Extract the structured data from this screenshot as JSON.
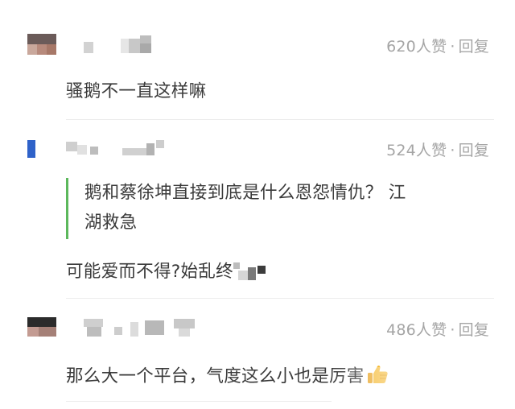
{
  "comments": [
    {
      "likes": "620人赞",
      "separator": "·",
      "reply_label": "回复",
      "text": "骚鹅不一直这样嘛"
    },
    {
      "likes": "524人赞",
      "separator": "·",
      "reply_label": "回复",
      "quote_line1": "鹅和蔡徐坤直接到底是什么恩怨情仇？ 江",
      "quote_line2": "湖救急",
      "text": "可能爱而不得?始乱终"
    },
    {
      "likes": "486人赞",
      "separator": "·",
      "reply_label": "回复",
      "text": "那么大一个平台，气度这么小也是厉害"
    }
  ],
  "icons": {
    "thumb": "thumbs-up-icon"
  },
  "colors": {
    "quote_bar": "#5cb85c",
    "meta": "#a5a5a5",
    "text": "#3a3a3a",
    "thumb": "#f5b82e"
  }
}
